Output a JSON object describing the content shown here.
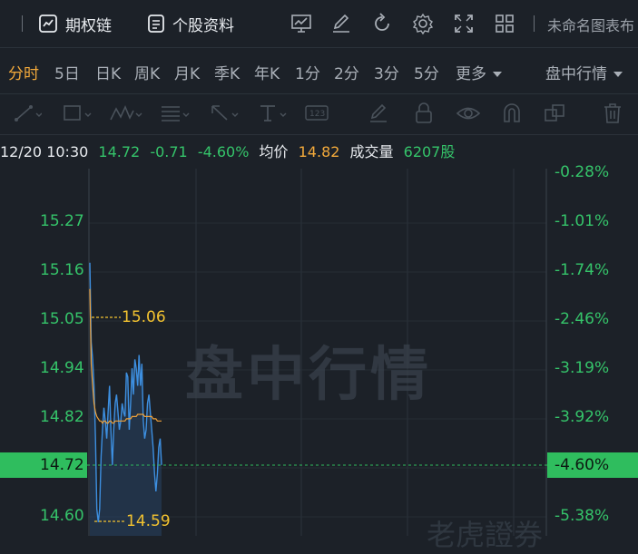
{
  "toolbar": {
    "options_chain": "期权链",
    "stock_profile": "个股资料",
    "chart_name": "未命名图表布"
  },
  "periods": [
    "分时",
    "5日",
    "日K",
    "周K",
    "月K",
    "季K",
    "年K",
    "1分",
    "2分",
    "3分",
    "5分"
  ],
  "more_label": "更多",
  "market_label": "盘中行情",
  "info": {
    "datetime": "12/20 10:30",
    "price": "14.72",
    "change": "-0.71",
    "change_pct": "-4.60%",
    "avg_label": "均价",
    "avg_value": "14.82",
    "volume_label": "成交量",
    "volume_value": "6207股"
  },
  "watermark": "盘中行情",
  "watermark2": "老虎證券",
  "colors": {
    "accent": "#f2a93b",
    "down": "#35c46a",
    "line": "#3d8fe0",
    "avg": "#f0a23a",
    "bg": "#1c2128"
  },
  "chart_data": {
    "type": "line",
    "y_price_ticks": [
      "15.27",
      "15.16",
      "15.05",
      "14.94",
      "14.82",
      "14.72",
      "14.60"
    ],
    "y_pct_ticks": [
      "-0.28%",
      "-1.01%",
      "-1.74%",
      "-2.46%",
      "-3.19%",
      "-3.92%",
      "-4.60%",
      "-5.38%"
    ],
    "current_price_label": "14.72",
    "current_pct_label": "-4.60%",
    "high_marker": "15.06",
    "low_marker": "14.59",
    "series": [
      {
        "values": [
          15.18,
          15.0,
          14.96,
          14.9,
          14.78,
          14.62,
          14.59,
          14.62,
          14.74,
          14.8,
          14.85,
          14.82,
          14.78,
          14.84,
          14.9,
          14.8,
          14.72,
          14.8,
          14.86,
          14.88,
          14.84,
          14.8,
          14.82,
          14.86,
          14.84,
          14.83,
          14.93,
          14.92,
          14.8,
          14.86,
          14.94,
          14.88,
          14.96,
          14.94,
          14.9,
          14.97,
          14.9,
          14.95,
          14.82,
          14.78,
          14.8,
          14.86,
          14.88,
          14.84,
          14.8,
          14.76,
          14.7,
          14.66,
          14.7,
          14.76,
          14.78,
          14.72
        ]
      },
      {
        "values": [
          15.12,
          14.95,
          14.9,
          14.86,
          14.84,
          14.83,
          14.825,
          14.82,
          14.82,
          14.815,
          14.82,
          14.82,
          14.815,
          14.815,
          14.82,
          14.82,
          14.815,
          14.815,
          14.82,
          14.82,
          14.82,
          14.82,
          14.82,
          14.82,
          14.82,
          14.82,
          14.825,
          14.825,
          14.825,
          14.825,
          14.83,
          14.83,
          14.83,
          14.83,
          14.835,
          14.835,
          14.835,
          14.835,
          14.835,
          14.83,
          14.83,
          14.83,
          14.83,
          14.83,
          14.83,
          14.825,
          14.825,
          14.825,
          14.82,
          14.82,
          14.82,
          14.82
        ]
      }
    ]
  }
}
